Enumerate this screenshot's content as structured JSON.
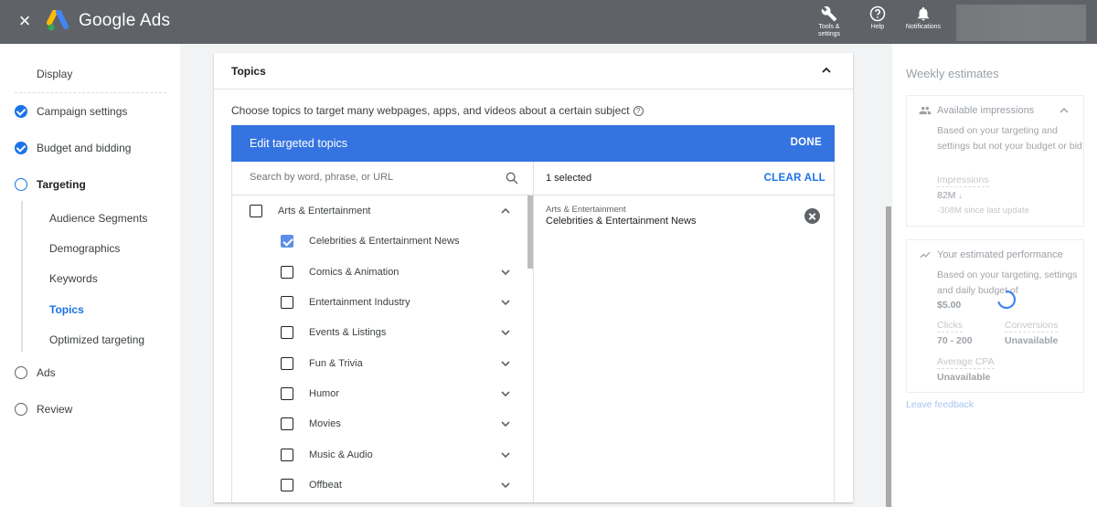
{
  "topbar": {
    "close_label": "×",
    "brand": "Google Ads",
    "actions": [
      {
        "icon": "wrench-icon",
        "label_line1": "Tools &",
        "label_line2": "settings"
      },
      {
        "icon": "help-icon",
        "label_line1": "Help",
        "label_line2": ""
      },
      {
        "icon": "bell-icon",
        "label_line1": "Notifications",
        "label_line2": ""
      }
    ]
  },
  "leftnav": {
    "campaign_type": "Display",
    "steps": [
      {
        "label": "Campaign settings",
        "state": "done"
      },
      {
        "label": "Budget and bidding",
        "state": "done"
      },
      {
        "label": "Targeting",
        "state": "current"
      },
      {
        "label": "Ads",
        "state": "todo"
      },
      {
        "label": "Review",
        "state": "todo"
      }
    ],
    "targeting_subitems": [
      {
        "label": "Audience Segments",
        "active": false
      },
      {
        "label": "Demographics",
        "active": false
      },
      {
        "label": "Keywords",
        "active": false
      },
      {
        "label": "Topics",
        "active": true
      },
      {
        "label": "Optimized targeting",
        "active": false
      }
    ]
  },
  "main": {
    "section_title": "Topics",
    "description": "Choose topics to target many webpages, apps, and videos about a certain subject",
    "help_glyph": "?",
    "editor": {
      "title": "Edit targeted topics",
      "done_label": "DONE",
      "search_placeholder": "Search by word, phrase, or URL",
      "search_value": "",
      "topics": [
        {
          "label": "Arts & Entertainment",
          "checked": false,
          "level": 0,
          "expanded": true
        },
        {
          "label": "Celebrities & Entertainment News",
          "checked": true,
          "level": 1,
          "expanded": null
        },
        {
          "label": "Comics & Animation",
          "checked": false,
          "level": 1,
          "expanded": false
        },
        {
          "label": "Entertainment Industry",
          "checked": false,
          "level": 1,
          "expanded": false
        },
        {
          "label": "Events & Listings",
          "checked": false,
          "level": 1,
          "expanded": false
        },
        {
          "label": "Fun & Trivia",
          "checked": false,
          "level": 1,
          "expanded": false
        },
        {
          "label": "Humor",
          "checked": false,
          "level": 1,
          "expanded": false
        },
        {
          "label": "Movies",
          "checked": false,
          "level": 1,
          "expanded": false
        },
        {
          "label": "Music & Audio",
          "checked": false,
          "level": 1,
          "expanded": false
        },
        {
          "label": "Offbeat",
          "checked": false,
          "level": 1,
          "expanded": false
        }
      ],
      "selected_count_label": "1 selected",
      "clear_all_label": "CLEAR ALL",
      "selected": [
        {
          "parent": "Arts & Entertainment",
          "name": "Celebrities & Entertainment News"
        }
      ]
    }
  },
  "estimates": {
    "title": "Weekly estimates",
    "impressions_card": {
      "title": "Available impressions",
      "description": "Based on your targeting and settings but not your budget or bid",
      "metric_label": "Impressions",
      "metric_value": "82M",
      "trend": "down",
      "change_text": "-308M since last update"
    },
    "performance_card": {
      "title": "Your estimated performance",
      "description": "Based on your targeting, settings and daily budget of",
      "budget": "$5.00",
      "metrics": [
        {
          "label": "Clicks",
          "value": "70 - 200"
        },
        {
          "label": "Conversions",
          "value": "Unavailable"
        },
        {
          "label": "Average CPA",
          "value": "Unavailable"
        }
      ],
      "loading": true
    },
    "feedback_label": "Leave feedback"
  },
  "colors": {
    "topbar": "#5f6368",
    "accent": "#1a73e8",
    "editor_header": "#3574e0"
  }
}
